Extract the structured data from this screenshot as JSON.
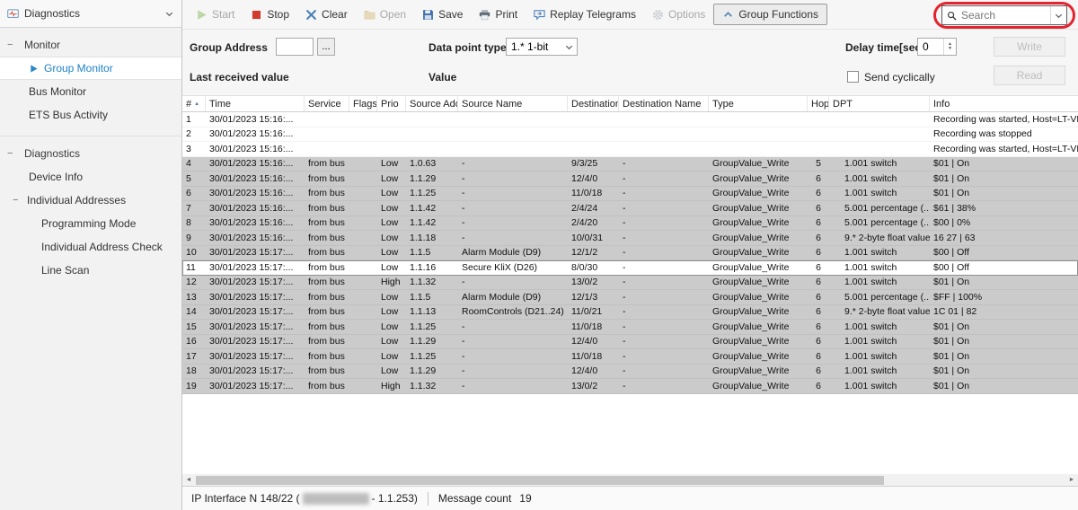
{
  "colors": {
    "accent_blue": "#1e82c8",
    "selection_gray": "#cbcbcb",
    "annotation_red": "#e4232e",
    "start_green": "#79b24a",
    "stop_red": "#d23b2f"
  },
  "sidebar": {
    "header": {
      "label": "Diagnostics"
    },
    "sections": [
      {
        "label": "Monitor",
        "items": [
          {
            "label": "Group Monitor",
            "selected": true,
            "icon": "play-blue"
          },
          {
            "label": "Bus Monitor"
          },
          {
            "label": "ETS Bus Activity"
          }
        ]
      },
      {
        "label": "Diagnostics",
        "items": [
          {
            "label": "Device Info"
          },
          {
            "label": "Individual Addresses",
            "children": [
              {
                "label": "Programming Mode"
              },
              {
                "label": "Individual Address Check"
              },
              {
                "label": "Line Scan"
              }
            ]
          }
        ]
      }
    ]
  },
  "toolbar": {
    "buttons": [
      {
        "label": "Start",
        "icon": "play",
        "state": "disabled"
      },
      {
        "label": "Stop",
        "icon": "stop",
        "state": ""
      },
      {
        "label": "Clear",
        "icon": "clear",
        "state": ""
      },
      {
        "label": "Open",
        "icon": "open",
        "state": "disabled"
      },
      {
        "label": "Save",
        "icon": "save",
        "state": ""
      },
      {
        "label": "Print",
        "icon": "print",
        "state": ""
      },
      {
        "label": "Replay Telegrams",
        "icon": "replay",
        "state": ""
      },
      {
        "label": "Options",
        "icon": "gear",
        "state": "disabled"
      },
      {
        "label": "Group Functions",
        "icon": "chevron-up",
        "state": "toggled"
      }
    ],
    "search": {
      "placeholder": "Search"
    }
  },
  "params": {
    "group_address_label": "Group Address",
    "group_address_value": "",
    "browse_label": "...",
    "data_point_type_label": "Data point type",
    "data_point_type_value": "1.* 1-bit",
    "delay_label": "Delay time[sec]",
    "delay_value": "0",
    "write_label": "Write",
    "read_label": "Read",
    "last_received_label": "Last received value",
    "value_label": "Value",
    "send_cyclically_label": "Send cyclically"
  },
  "table": {
    "columns": [
      {
        "label": "#",
        "sort": "asc"
      },
      {
        "label": "Time"
      },
      {
        "label": "Service"
      },
      {
        "label": "Flags"
      },
      {
        "label": "Prio"
      },
      {
        "label": "Source Add"
      },
      {
        "label": "Source Name"
      },
      {
        "label": "Destination"
      },
      {
        "label": "Destination Name"
      },
      {
        "label": "Type"
      },
      {
        "label": "Hop"
      },
      {
        "label": "DPT"
      },
      {
        "label": "Info"
      }
    ],
    "rows": [
      {
        "state": "none",
        "cells": [
          "1",
          "30/01/2023 15:16:...",
          "",
          "",
          "",
          "",
          "",
          "",
          "",
          "",
          "",
          "",
          "Recording was started, Host=LT-VL-..."
        ]
      },
      {
        "state": "none",
        "cells": [
          "2",
          "30/01/2023 15:16:...",
          "",
          "",
          "",
          "",
          "",
          "",
          "",
          "",
          "",
          "",
          "Recording was stopped"
        ]
      },
      {
        "state": "none",
        "cells": [
          "3",
          "30/01/2023 15:16:...",
          "",
          "",
          "",
          "",
          "",
          "",
          "",
          "",
          "",
          "",
          "Recording was started, Host=LT-VL-..."
        ]
      },
      {
        "state": "selected",
        "cells": [
          "4",
          "30/01/2023 15:16:...",
          "from bus",
          "",
          "Low",
          "1.0.63",
          "-",
          "9/3/25",
          "-",
          "GroupValue_Write",
          "5",
          "1.001 switch",
          "$01 | On"
        ]
      },
      {
        "state": "selected",
        "cells": [
          "5",
          "30/01/2023 15:16:...",
          "from bus",
          "",
          "Low",
          "1.1.29",
          "-",
          "12/4/0",
          "-",
          "GroupValue_Write",
          "6",
          "1.001 switch",
          "$01 | On"
        ]
      },
      {
        "state": "selected",
        "cells": [
          "6",
          "30/01/2023 15:16:...",
          "from bus",
          "",
          "Low",
          "1.1.25",
          "-",
          "11/0/18",
          "-",
          "GroupValue_Write",
          "6",
          "1.001 switch",
          "$01 | On"
        ]
      },
      {
        "state": "selected",
        "cells": [
          "7",
          "30/01/2023 15:16:...",
          "from bus",
          "",
          "Low",
          "1.1.42",
          "-",
          "2/4/24",
          "-",
          "GroupValue_Write",
          "6",
          "5.001 percentage (...",
          "$61 | 38%"
        ]
      },
      {
        "state": "selected",
        "cells": [
          "8",
          "30/01/2023 15:16:...",
          "from bus",
          "",
          "Low",
          "1.1.42",
          "-",
          "2/4/20",
          "-",
          "GroupValue_Write",
          "6",
          "5.001 percentage (...",
          "$00 | 0%"
        ]
      },
      {
        "state": "selected",
        "cells": [
          "9",
          "30/01/2023 15:16:...",
          "from bus",
          "",
          "Low",
          "1.1.18",
          "-",
          "10/0/31",
          "-",
          "GroupValue_Write",
          "6",
          "9.* 2-byte float value",
          "16 27 | 63"
        ]
      },
      {
        "state": "selected",
        "cells": [
          "10",
          "30/01/2023 15:17:...",
          "from bus",
          "",
          "Low",
          "1.1.5",
          "Alarm Module (D9)",
          "12/1/2",
          "-",
          "GroupValue_Write",
          "6",
          "1.001 switch",
          "$00 | Off"
        ]
      },
      {
        "state": "current",
        "cells": [
          "11",
          "30/01/2023 15:17:...",
          "from bus",
          "",
          "Low",
          "1.1.16",
          "Secure KliX (D26)",
          "8/0/30",
          "-",
          "GroupValue_Write",
          "6",
          "1.001 switch",
          "$00 | Off"
        ]
      },
      {
        "state": "selected",
        "cells": [
          "12",
          "30/01/2023 15:17:...",
          "from bus",
          "",
          "High",
          "1.1.32",
          "-",
          "13/0/2",
          "-",
          "GroupValue_Write",
          "6",
          "1.001 switch",
          "$01 | On"
        ]
      },
      {
        "state": "selected",
        "cells": [
          "13",
          "30/01/2023 15:17:...",
          "from bus",
          "",
          "Low",
          "1.1.5",
          "Alarm Module (D9)",
          "12/1/3",
          "-",
          "GroupValue_Write",
          "6",
          "5.001 percentage (...",
          "$FF | 100%"
        ]
      },
      {
        "state": "selected",
        "cells": [
          "14",
          "30/01/2023 15:17:...",
          "from bus",
          "",
          "Low",
          "1.1.13",
          "RoomControls (D21..24)",
          "11/0/21",
          "-",
          "GroupValue_Write",
          "6",
          "9.* 2-byte float value",
          "1C 01 | 82"
        ]
      },
      {
        "state": "selected",
        "cells": [
          "15",
          "30/01/2023 15:17:...",
          "from bus",
          "",
          "Low",
          "1.1.25",
          "-",
          "11/0/18",
          "-",
          "GroupValue_Write",
          "6",
          "1.001 switch",
          "$01 | On"
        ]
      },
      {
        "state": "selected",
        "cells": [
          "16",
          "30/01/2023 15:17:...",
          "from bus",
          "",
          "Low",
          "1.1.29",
          "-",
          "12/4/0",
          "-",
          "GroupValue_Write",
          "6",
          "1.001 switch",
          "$01 | On"
        ]
      },
      {
        "state": "selected",
        "cells": [
          "17",
          "30/01/2023 15:17:...",
          "from bus",
          "",
          "Low",
          "1.1.25",
          "-",
          "11/0/18",
          "-",
          "GroupValue_Write",
          "6",
          "1.001 switch",
          "$01 | On"
        ]
      },
      {
        "state": "selected",
        "cells": [
          "18",
          "30/01/2023 15:17:...",
          "from bus",
          "",
          "Low",
          "1.1.29",
          "-",
          "12/4/0",
          "-",
          "GroupValue_Write",
          "6",
          "1.001 switch",
          "$01 | On"
        ]
      },
      {
        "state": "selected",
        "cells": [
          "19",
          "30/01/2023 15:17:...",
          "from bus",
          "",
          "High",
          "1.1.32",
          "-",
          "13/0/2",
          "-",
          "GroupValue_Write",
          "6",
          "1.001 switch",
          "$01 | On"
        ]
      }
    ]
  },
  "statusbar": {
    "interface_prefix": "IP Interface N 148/22 (",
    "interface_suffix": " - 1.1.253)",
    "message_count_label": "Message count",
    "message_count_value": "19"
  }
}
